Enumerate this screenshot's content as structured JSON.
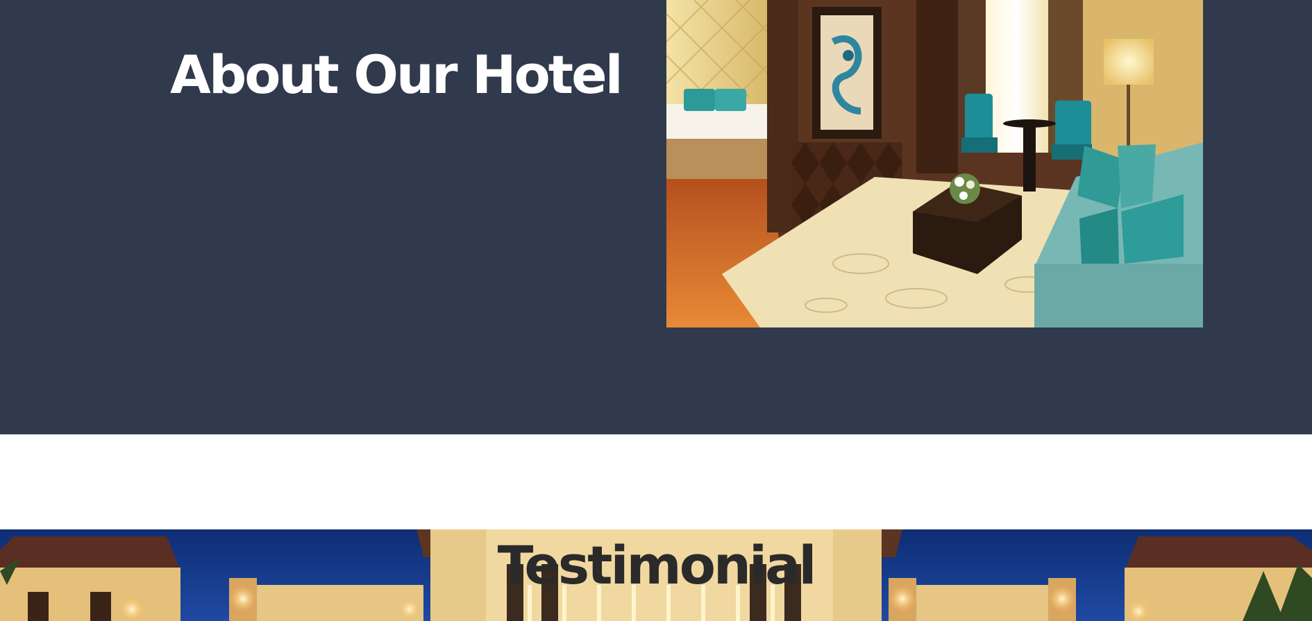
{
  "about": {
    "title": "About Our Hotel",
    "background_color": "#313a4c",
    "image": "hotel-room-photo"
  },
  "testimonial": {
    "title": "Testimonial",
    "background_image": "hotel-exterior-night-photo"
  }
}
